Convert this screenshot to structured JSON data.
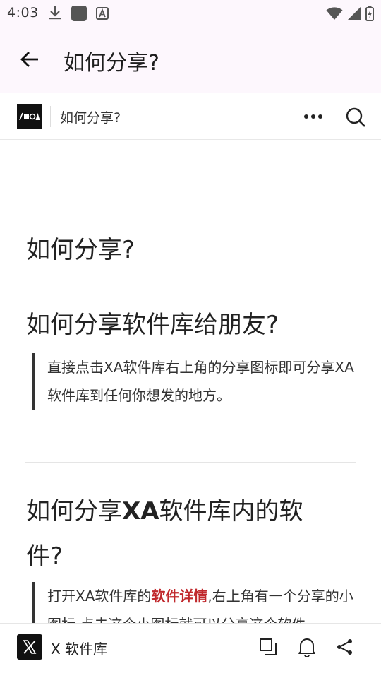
{
  "status_bar": {
    "time": "4:03",
    "icons": [
      "download-icon",
      "app-square-icon",
      "a-badge-icon",
      "wifi-icon",
      "signal-icon",
      "battery-charging-icon"
    ]
  },
  "app_bar": {
    "title": "如何分享?"
  },
  "site_header": {
    "logo_text": "/■◎A",
    "title": "如何分享?"
  },
  "article": {
    "heading": "如何分享?",
    "section1": {
      "heading": "如何分享软件库给朋友?",
      "quote": "直接点击XA软件库右上角的分享图标即可分享XA软件库到任何你想发的地方。"
    },
    "section2": {
      "heading_prefix": "如何分享",
      "heading_bold": "XA",
      "heading_suffix": "软件库内的软件?",
      "quote_prefix": "打开XA软件库的",
      "quote_link": "软件详情",
      "quote_suffix": ",右上角有一个分享的小图标,点击这个小图标就可以分享这个软件。"
    }
  },
  "bottom_bar": {
    "logo_letter": "X",
    "title": "X 软件库"
  },
  "colors": {
    "header_bg": "#fdf7fd",
    "link_red": "#c0282c",
    "quote_border": "#333333"
  }
}
